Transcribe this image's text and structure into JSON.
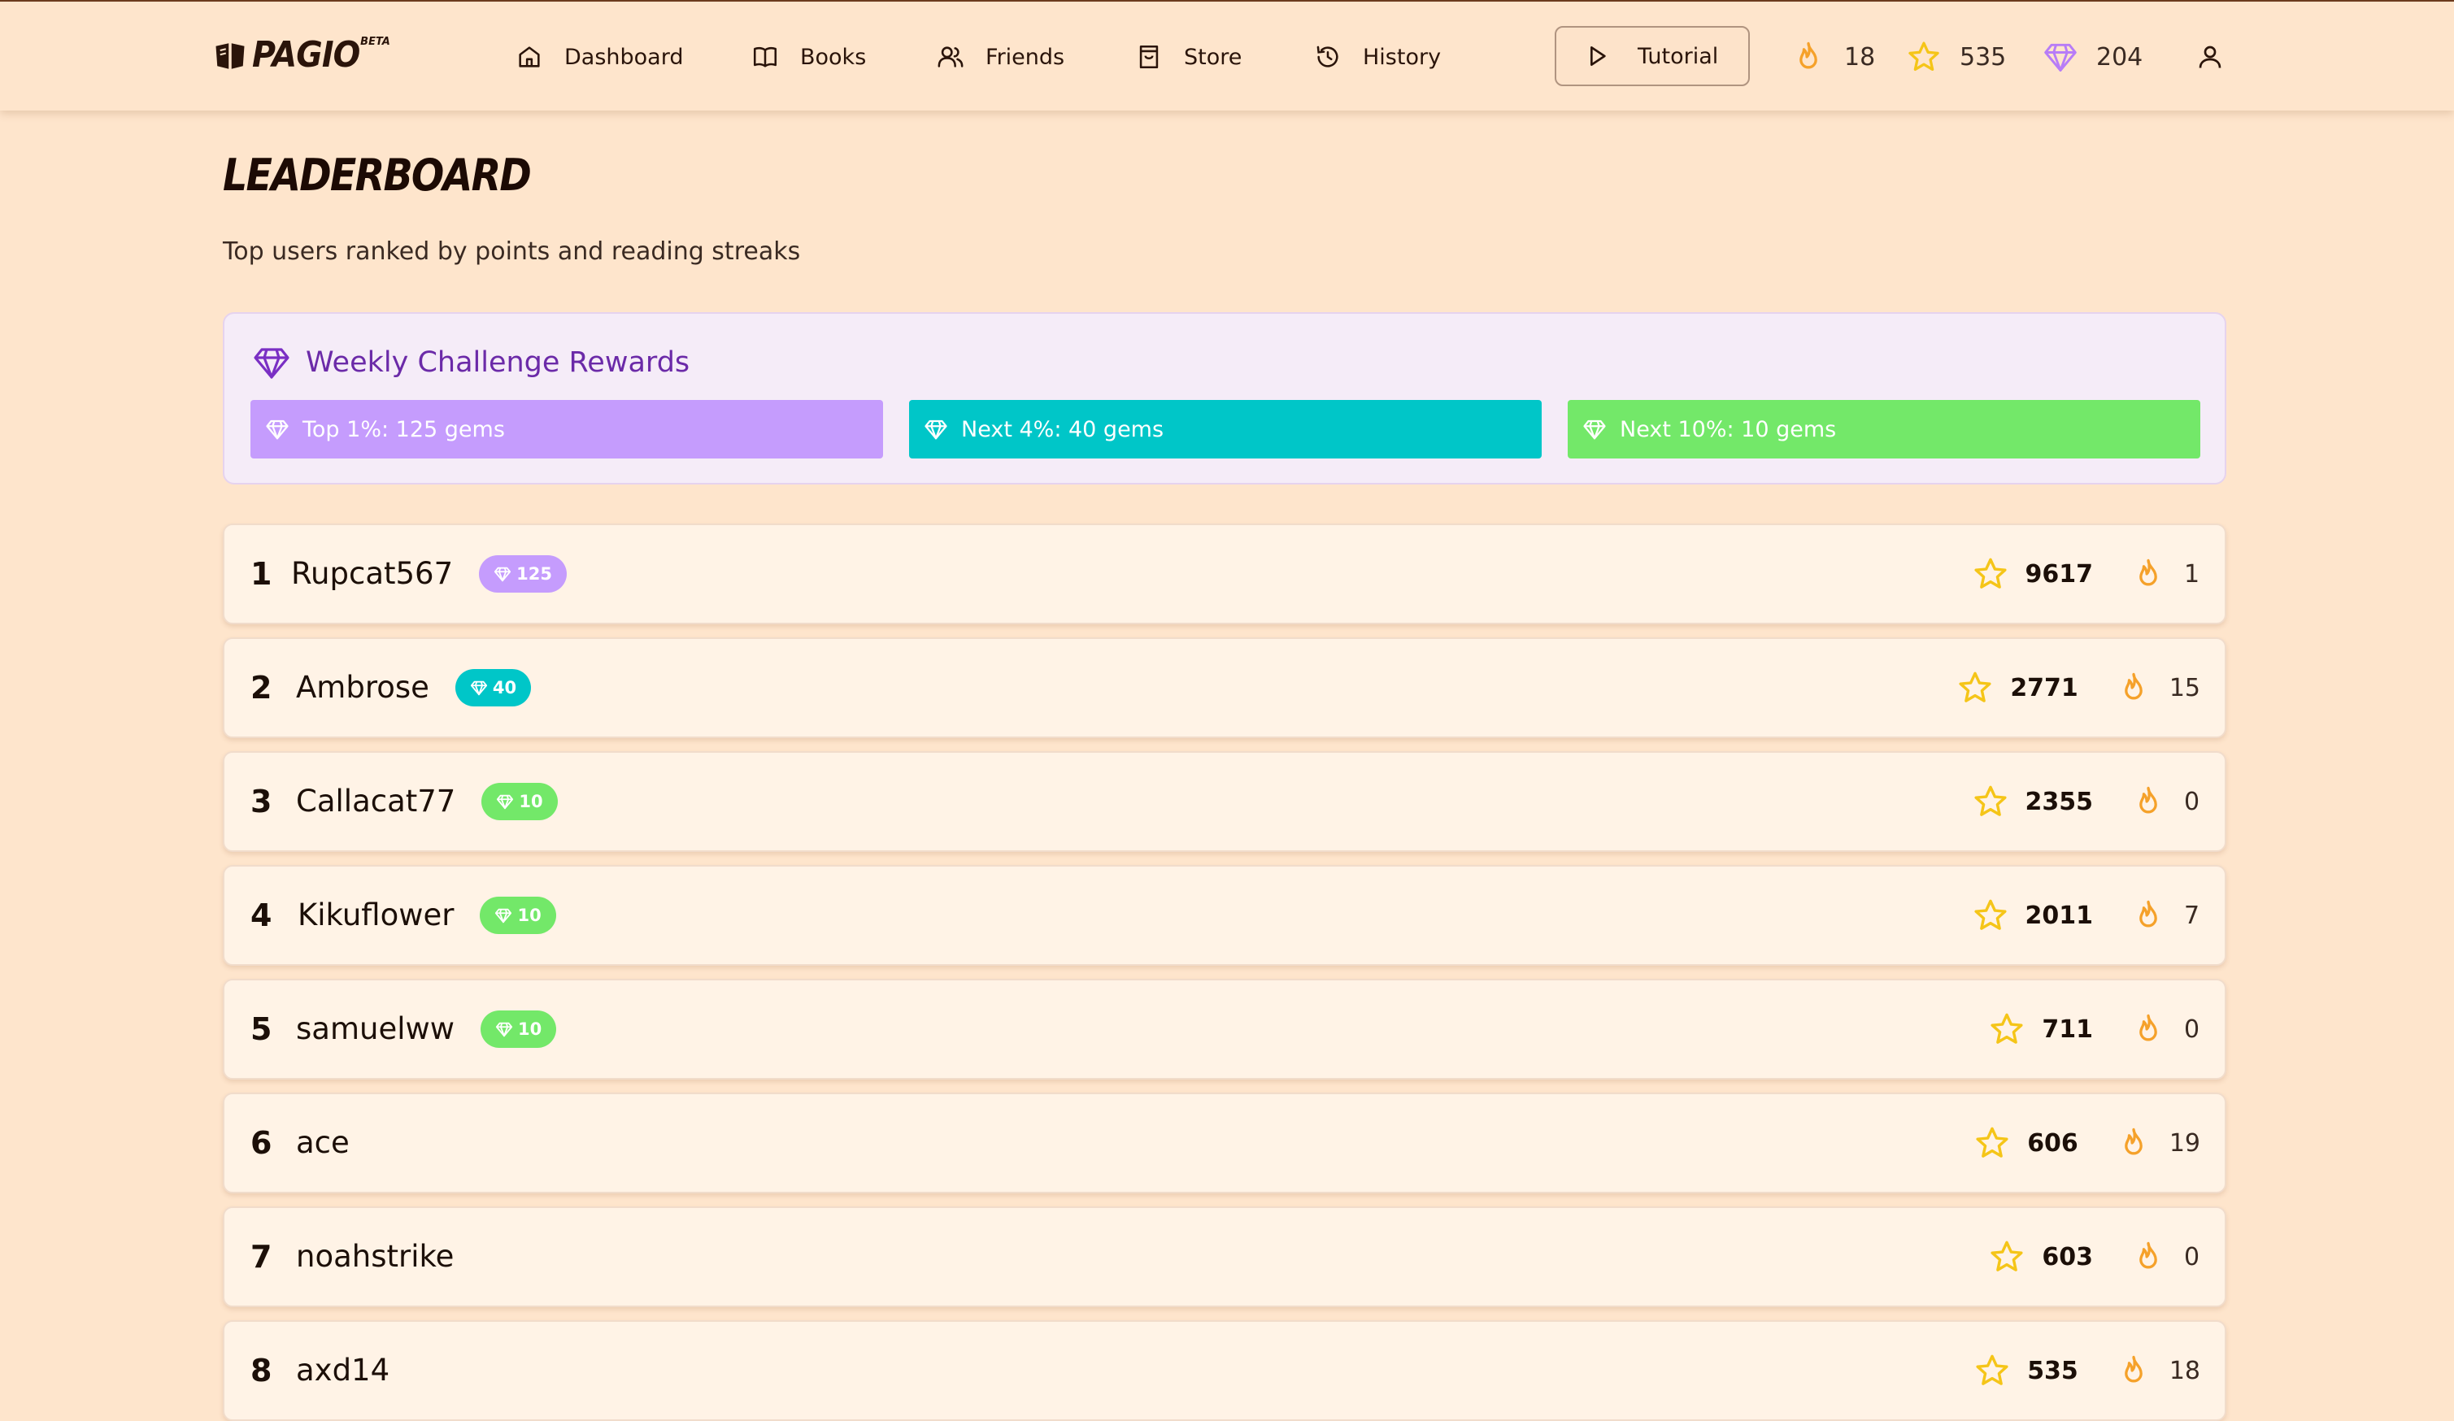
{
  "app": {
    "logo_text": "PAGIO",
    "logo_badge": "BETA"
  },
  "nav": {
    "items": [
      {
        "label": "Dashboard",
        "icon": "home-icon"
      },
      {
        "label": "Books",
        "icon": "book-icon"
      },
      {
        "label": "Friends",
        "icon": "friends-icon"
      },
      {
        "label": "Store",
        "icon": "shopping-bag-icon"
      },
      {
        "label": "History",
        "icon": "history-icon"
      }
    ],
    "tutorial_label": "Tutorial"
  },
  "user_stats": {
    "streak": "18",
    "points": "535",
    "gems": "204"
  },
  "page": {
    "title": "LEADERBOARD",
    "subtitle": "Top users ranked by points and reading streaks"
  },
  "rewards": {
    "title": "Weekly Challenge Rewards",
    "tiers": [
      {
        "label": "Top 1%: 125 gems",
        "color": "#c59cfd"
      },
      {
        "label": "Next 4%: 40 gems",
        "color": "#00c6c8"
      },
      {
        "label": "Next 10%: 10 gems",
        "color": "#73e869"
      }
    ]
  },
  "leaderboard": [
    {
      "rank": "1",
      "name": "Rupcat567",
      "badge": "125",
      "badge_color": "#c59cfd",
      "points": "9617",
      "streak": "1"
    },
    {
      "rank": "2",
      "name": "Ambrose",
      "badge": "40",
      "badge_color": "#00c6c8",
      "points": "2771",
      "streak": "15"
    },
    {
      "rank": "3",
      "name": "Callacat77",
      "badge": "10",
      "badge_color": "#73e869",
      "points": "2355",
      "streak": "0"
    },
    {
      "rank": "4",
      "name": "Kikuflower",
      "badge": "10",
      "badge_color": "#73e869",
      "points": "2011",
      "streak": "7"
    },
    {
      "rank": "5",
      "name": "samuelww",
      "badge": "10",
      "badge_color": "#73e869",
      "points": "711",
      "streak": "0"
    },
    {
      "rank": "6",
      "name": "ace",
      "badge": "",
      "badge_color": "",
      "points": "606",
      "streak": "19"
    },
    {
      "rank": "7",
      "name": "noahstrike",
      "badge": "",
      "badge_color": "",
      "points": "603",
      "streak": "0"
    },
    {
      "rank": "8",
      "name": "axd14",
      "badge": "",
      "badge_color": "",
      "points": "535",
      "streak": "18"
    }
  ],
  "colors": {
    "background": "#fee5cc",
    "star": "#f5c518",
    "flame": "#f5a12a",
    "gem": "#b77cf7",
    "rewards_title": "#6b2aa8"
  }
}
